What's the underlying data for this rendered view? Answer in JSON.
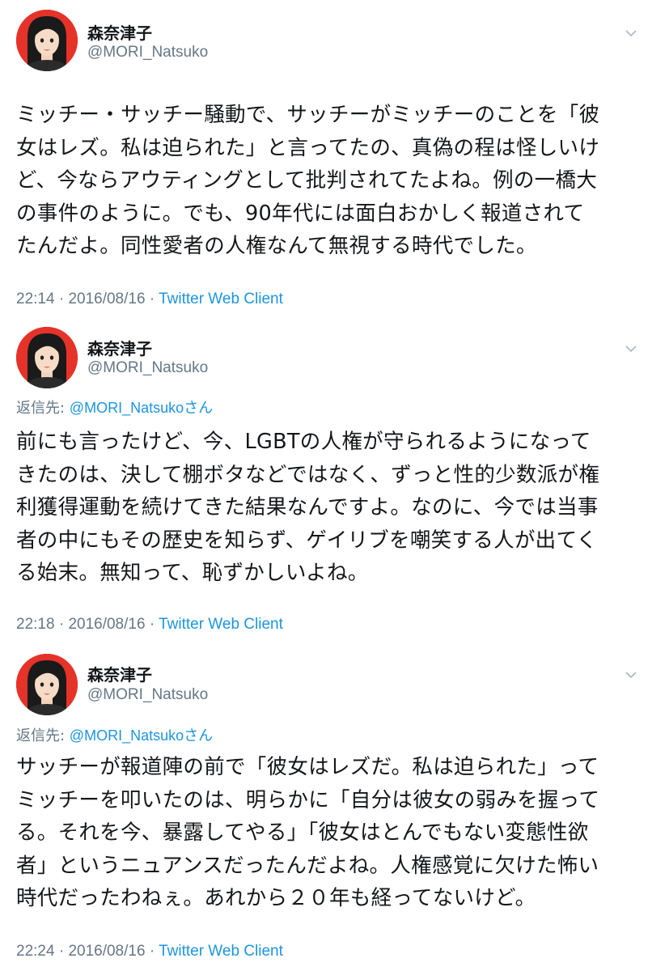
{
  "tweets": [
    {
      "display_name": "森奈津子",
      "handle": "@MORI_Natsuko",
      "reply_label": "",
      "reply_handle": "",
      "reply_suffix": "",
      "lines": [
        "ミッチー・サッチー騒動で、サッチーがミッチーのことを「彼",
        "女はレズ。私は迫られた」と言ってたの、真偽の程は怪しいけ",
        "ど、今ならアウティングとして批判されてたよね。例の一橋大",
        "の事件のように。でも、90年代には面白おかしく報道されて",
        "たんだよ。同性愛者の人権なんて無視する時代でした。"
      ],
      "time": "22:14",
      "date": "2016/08/16",
      "separator": "·",
      "client": "Twitter Web Client"
    },
    {
      "display_name": "森奈津子",
      "handle": "@MORI_Natsuko",
      "reply_label": "返信先: ",
      "reply_handle": "@MORI_Natsuko",
      "reply_suffix": "さん",
      "lines": [
        "前にも言ったけど、今、LGBTの人権が守られるようになって",
        "きたのは、決して棚ボタなどではなく、ずっと性的少数派が権",
        "利獲得運動を続けてきた結果なんですよ。なのに、今では当事",
        "者の中にもその歴史を知らず、ゲイリブを嘲笑する人が出てく",
        "る始末。無知って、恥ずかしいよね。"
      ],
      "time": "22:18",
      "date": "2016/08/16",
      "separator": "·",
      "client": "Twitter Web Client"
    },
    {
      "display_name": "森奈津子",
      "handle": "@MORI_Natsuko",
      "reply_label": "返信先: ",
      "reply_handle": "@MORI_Natsuko",
      "reply_suffix": "さん",
      "lines": [
        "サッチーが報道陣の前で「彼女はレズだ。私は迫られた」って",
        "ミッチーを叩いたのは、明らかに「自分は彼女の弱みを握って",
        "る。それを今、暴露してやる」「彼女はとんでもない変態性欲",
        "者」というニュアンスだったんだよね。人権感覚に欠けた怖い",
        "時代だったわねぇ。あれから２０年も経ってないけど。"
      ],
      "time": "22:24",
      "date": "2016/08/16",
      "separator": "·",
      "client": "Twitter Web Client"
    }
  ],
  "icons": {
    "avatar": "illustrated-woman-avatar",
    "menu": "chevron-down-icon"
  },
  "colors": {
    "text": "#14171a",
    "secondary": "#657786",
    "link": "#1b95e0",
    "avatar_bg": "#e5332a"
  }
}
